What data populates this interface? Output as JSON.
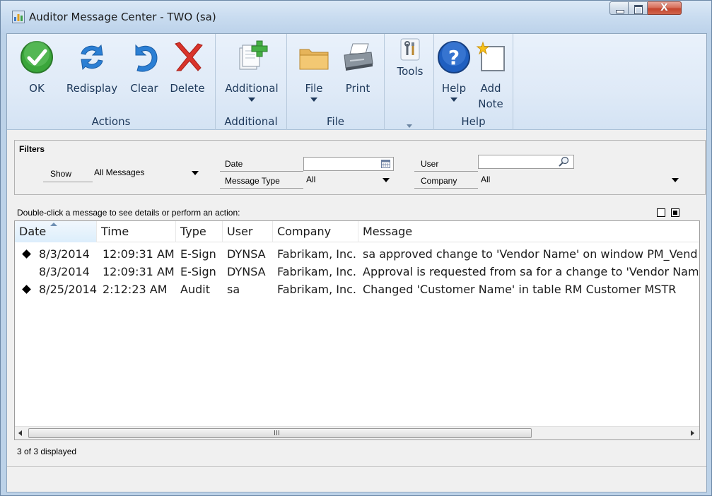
{
  "window": {
    "title": "Auditor Message Center  -  TWO (sa)"
  },
  "ribbon": {
    "groups": [
      {
        "label": "Actions"
      },
      {
        "label": "Additional"
      },
      {
        "label": "File"
      },
      {
        "label": "Help"
      }
    ],
    "buttons": {
      "ok": "OK",
      "redisplay": "Redisplay",
      "clear": "Clear",
      "delete": "Delete",
      "additional": "Additional",
      "file": "File",
      "print": "Print",
      "tools": "Tools",
      "help": "Help",
      "add_note_line1": "Add",
      "add_note_line2": "Note"
    }
  },
  "filters": {
    "title": "Filters",
    "show_label": "Show",
    "show_value": "All Messages",
    "date_label": "Date",
    "date_value": "",
    "message_type_label": "Message Type",
    "message_type_value": "All",
    "user_label": "User",
    "user_value": "",
    "company_label": "Company",
    "company_value": "All"
  },
  "list": {
    "hint": "Double-click a message to see details or perform an action:",
    "columns": [
      "Date",
      "Time",
      "Type",
      "User",
      "Company",
      "Message"
    ],
    "sorted_column": "Date",
    "rows": [
      {
        "flag": true,
        "date": "8/3/2014",
        "time": "12:09:31 AM",
        "type": "E-Sign",
        "user": "DYNSA",
        "company": "Fabrikam, Inc.",
        "message": "sa approved change to 'Vendor Name' on window PM_Vendo"
      },
      {
        "flag": false,
        "date": "8/3/2014",
        "time": "12:09:31 AM",
        "type": "E-Sign",
        "user": "DYNSA",
        "company": "Fabrikam, Inc.",
        "message": "Approval is requested from sa for a change to 'Vendor Name"
      },
      {
        "flag": true,
        "date": "8/25/2014",
        "time": "2:12:23 AM",
        "type": "Audit",
        "user": "sa",
        "company": "Fabrikam, Inc.",
        "message": "Changed 'Customer Name' in table RM Customer MSTR"
      }
    ]
  },
  "status": {
    "count_text": "3 of 3 displayed"
  },
  "colors": {
    "ribbon_text": "#1e395b",
    "ok_green": "#3aa63a",
    "delete_red": "#d9342b",
    "refresh_blue": "#2b7fd4",
    "help_blue": "#1f5fc0"
  }
}
